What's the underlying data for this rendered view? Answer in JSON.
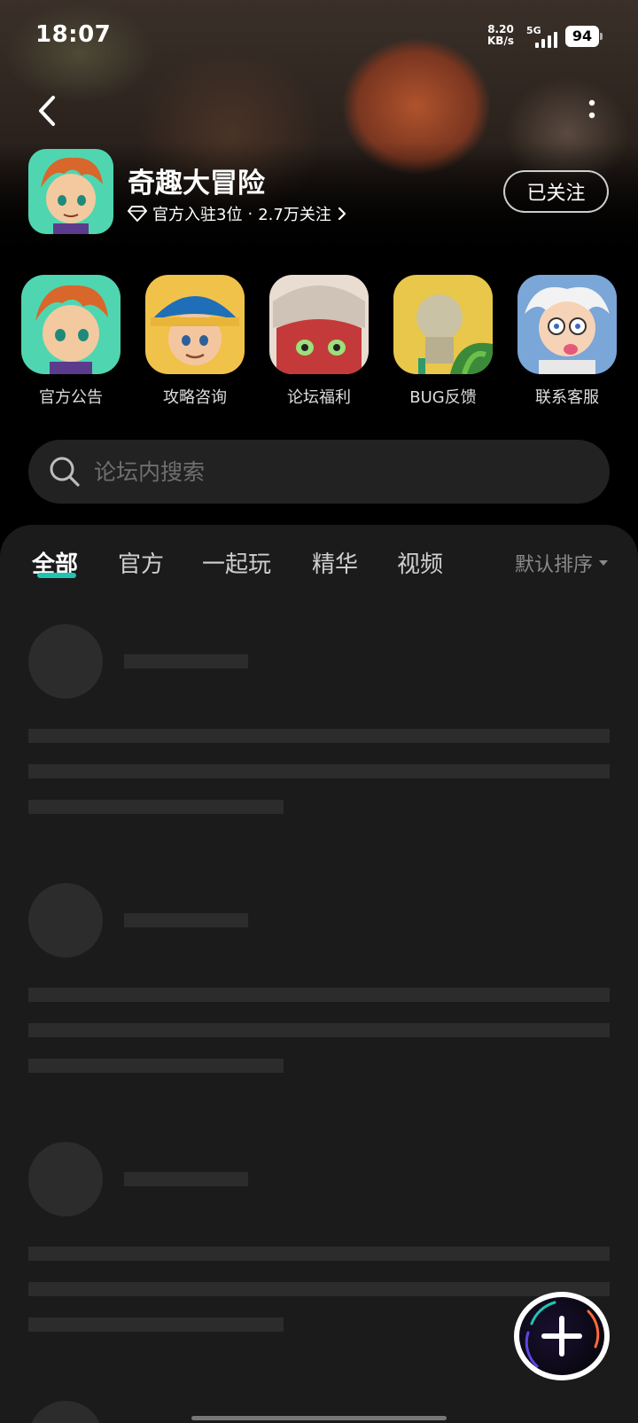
{
  "status_bar": {
    "time": "18:07",
    "speed_value": "8.20",
    "speed_unit": "KB/s",
    "network": "5G",
    "battery": "94"
  },
  "header": {
    "game_title": "奇趣大冒险",
    "official_settled": "官方入驻3位",
    "separator": "·",
    "followers": "2.7万关注",
    "follow_button": "已关注"
  },
  "shortcuts": [
    {
      "label": "官方公告",
      "icon": "hero-boy-icon"
    },
    {
      "label": "攻略咨询",
      "icon": "pirate-captain-icon"
    },
    {
      "label": "论坛福利",
      "icon": "dragon-skull-icon"
    },
    {
      "label": "BUG反馈",
      "icon": "goblin-statue-icon"
    },
    {
      "label": "联系客服",
      "icon": "professor-icon"
    }
  ],
  "search": {
    "placeholder": "论坛内搜索"
  },
  "tabs": [
    {
      "label": "全部",
      "active": true
    },
    {
      "label": "官方",
      "active": false
    },
    {
      "label": "一起玩",
      "active": false
    },
    {
      "label": "精华",
      "active": false
    },
    {
      "label": "视频",
      "active": false
    }
  ],
  "sort": {
    "label": "默认排序"
  },
  "colors": {
    "accent": "#1fc5b3",
    "panel_bg": "#1b1b1b",
    "skeleton": "#2c2c2c"
  }
}
